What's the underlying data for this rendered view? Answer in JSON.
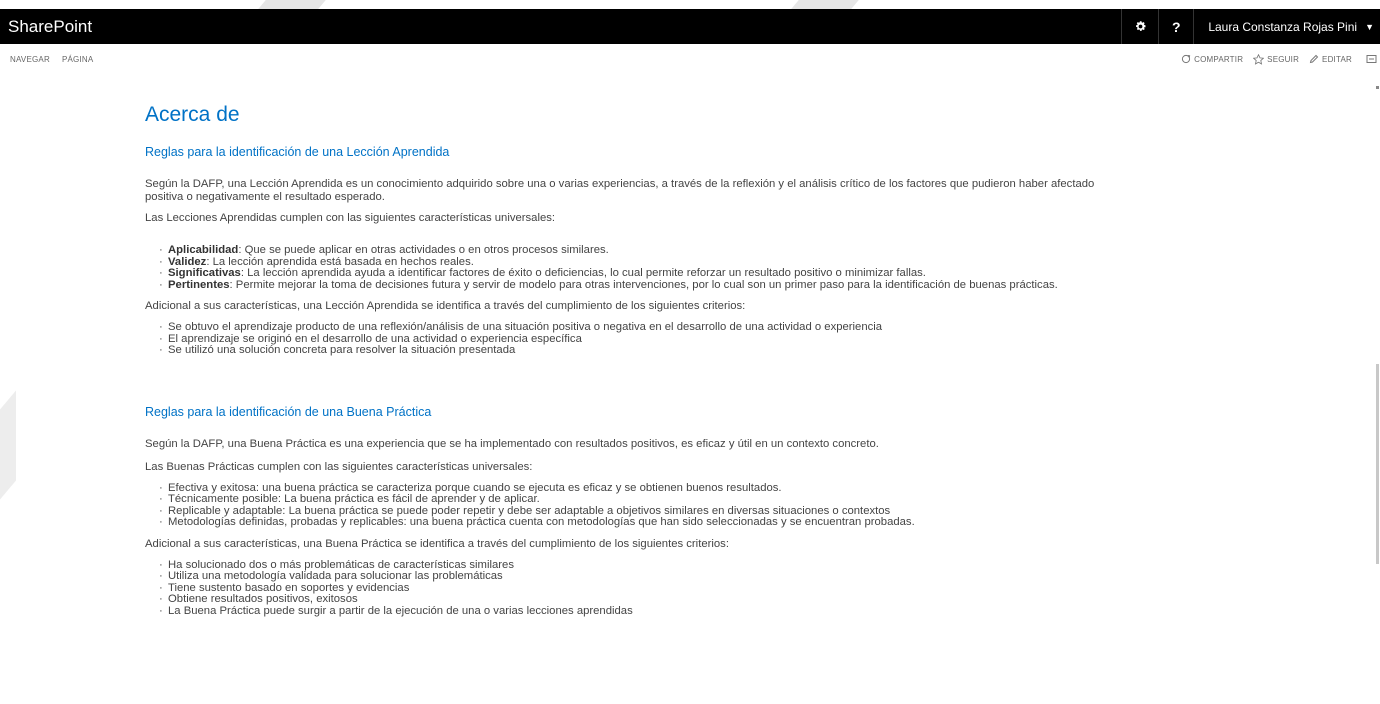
{
  "suitebar": {
    "brand": "SharePoint",
    "user_name": "Laura Constanza Rojas Pini"
  },
  "ribbon": {
    "tabs": [
      "NAVEGAR",
      "PÁGINA"
    ],
    "actions": {
      "share": "COMPARTIR",
      "follow": "SEGUIR",
      "edit": "EDITAR"
    }
  },
  "page": {
    "title": "Acerca de",
    "lessons": {
      "heading": "Reglas para la identificación de una Lección Aprendida",
      "intro_line1": "Según la DAFP, una Lección Aprendida es un conocimiento adquirido sobre una o varias experiencias, a través de la reflexión y el análisis crítico de los factores que pudieron haber afectado",
      "intro_line2": "positiva o negativamente el resultado esperado.",
      "characteristics_intro": "Las Lecciones Aprendidas cumplen con las siguientes características universales:",
      "characteristics": [
        {
          "term": "Aplicabilidad",
          "text": ": Que se puede aplicar en otras actividades o en otros procesos similares."
        },
        {
          "term": "Validez",
          "text": ": La lección aprendida está basada en hechos reales."
        },
        {
          "term": "Significativas",
          "text": ": La lección aprendida ayuda a identificar factores de éxito o deficiencias, lo cual permite reforzar un resultado positivo o minimizar fallas."
        },
        {
          "term": "Pertinentes",
          "text": ": Permite mejorar la toma de decisiones futura y servir de modelo para otras intervenciones, por lo cual son un primer paso para la identificación de buenas prácticas."
        }
      ],
      "criteria_intro": "Adicional a sus características, una Lección Aprendida se identifica a través del cumplimiento de los siguientes criterios:",
      "criteria": [
        "Se obtuvo el aprendizaje producto de una reflexión/análisis de una situación positiva o negativa en el desarrollo de una actividad o experiencia",
        "El aprendizaje se originó en el desarrollo de una actividad o experiencia específica",
        "Se utilizó una solución concreta para resolver la situación presentada"
      ]
    },
    "practices": {
      "heading": "Reglas para la identificación de una Buena Práctica",
      "intro": "Según la DAFP, una Buena Práctica es una experiencia que se ha implementado con resultados positivos, es eficaz y útil en un contexto concreto.",
      "characteristics_intro": "Las Buenas Prácticas cumplen con las siguientes características universales:",
      "characteristics": [
        "Efectiva y exitosa: una buena práctica se caracteriza porque cuando se ejecuta es eficaz y se obtienen buenos resultados.",
        "Técnicamente posible: La buena práctica es fácil de aprender y de aplicar.",
        "Replicable y adaptable: La buena práctica se puede poder repetir y debe ser adaptable a objetivos similares en diversas situaciones o contextos",
        "Metodologías definidas, probadas y replicables: una buena práctica cuenta con metodologías que han sido seleccionadas y se encuentran probadas."
      ],
      "criteria_intro": "Adicional a sus características, una Buena Práctica se identifica a través del cumplimiento de los siguientes criterios:",
      "criteria": [
        "Ha solucionado dos o más problemáticas de características similares",
        "Utiliza una metodología validada para solucionar las problemáticas",
        "Tiene sustento basado en soportes y evidencias",
        "Obtiene resultados positivos, exitosos",
        "La Buena Práctica puede surgir a partir de la ejecución de una o varias lecciones aprendidas"
      ]
    }
  },
  "colors": {
    "suitebar_bg": "#000000",
    "accent_blue": "#0072c6",
    "body_text": "#444444"
  }
}
